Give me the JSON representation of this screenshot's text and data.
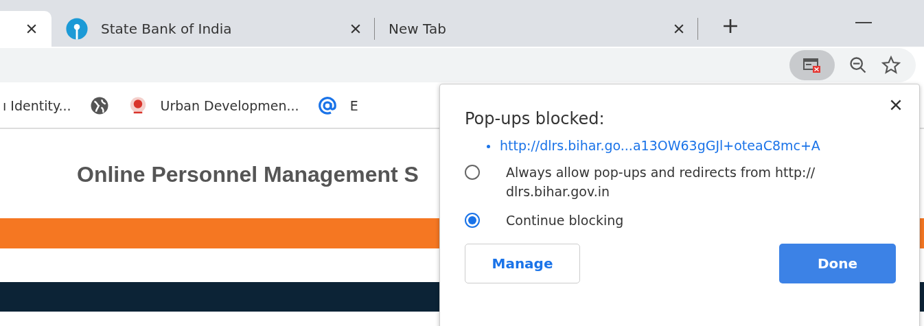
{
  "tabs": [
    {
      "selected": true
    },
    {
      "label": "State Bank of India",
      "selected": false
    },
    {
      "label": "New Tab",
      "selected": false
    }
  ],
  "bookmarks": [
    {
      "kind": "link",
      "label": "ı Identity..."
    },
    {
      "kind": "icon"
    },
    {
      "kind": "link",
      "label": "Urban Developmen..."
    },
    {
      "kind": "link",
      "label": "E"
    }
  ],
  "page": {
    "heading": "Online Personnel Management S"
  },
  "popup": {
    "title": "Pop-ups blocked:",
    "link": "http://dlrs.bihar.go...a13OW63gGJl+oteaC8mc+A",
    "options": [
      {
        "label": "Always allow pop-ups and redirects from http:// dlrs.bihar.gov.in",
        "selected": false
      },
      {
        "label": "Continue blocking",
        "selected": true
      }
    ],
    "buttons": [
      {
        "label": "Manage",
        "kind": "secondary"
      },
      {
        "label": "Done",
        "kind": "primary"
      }
    ]
  }
}
